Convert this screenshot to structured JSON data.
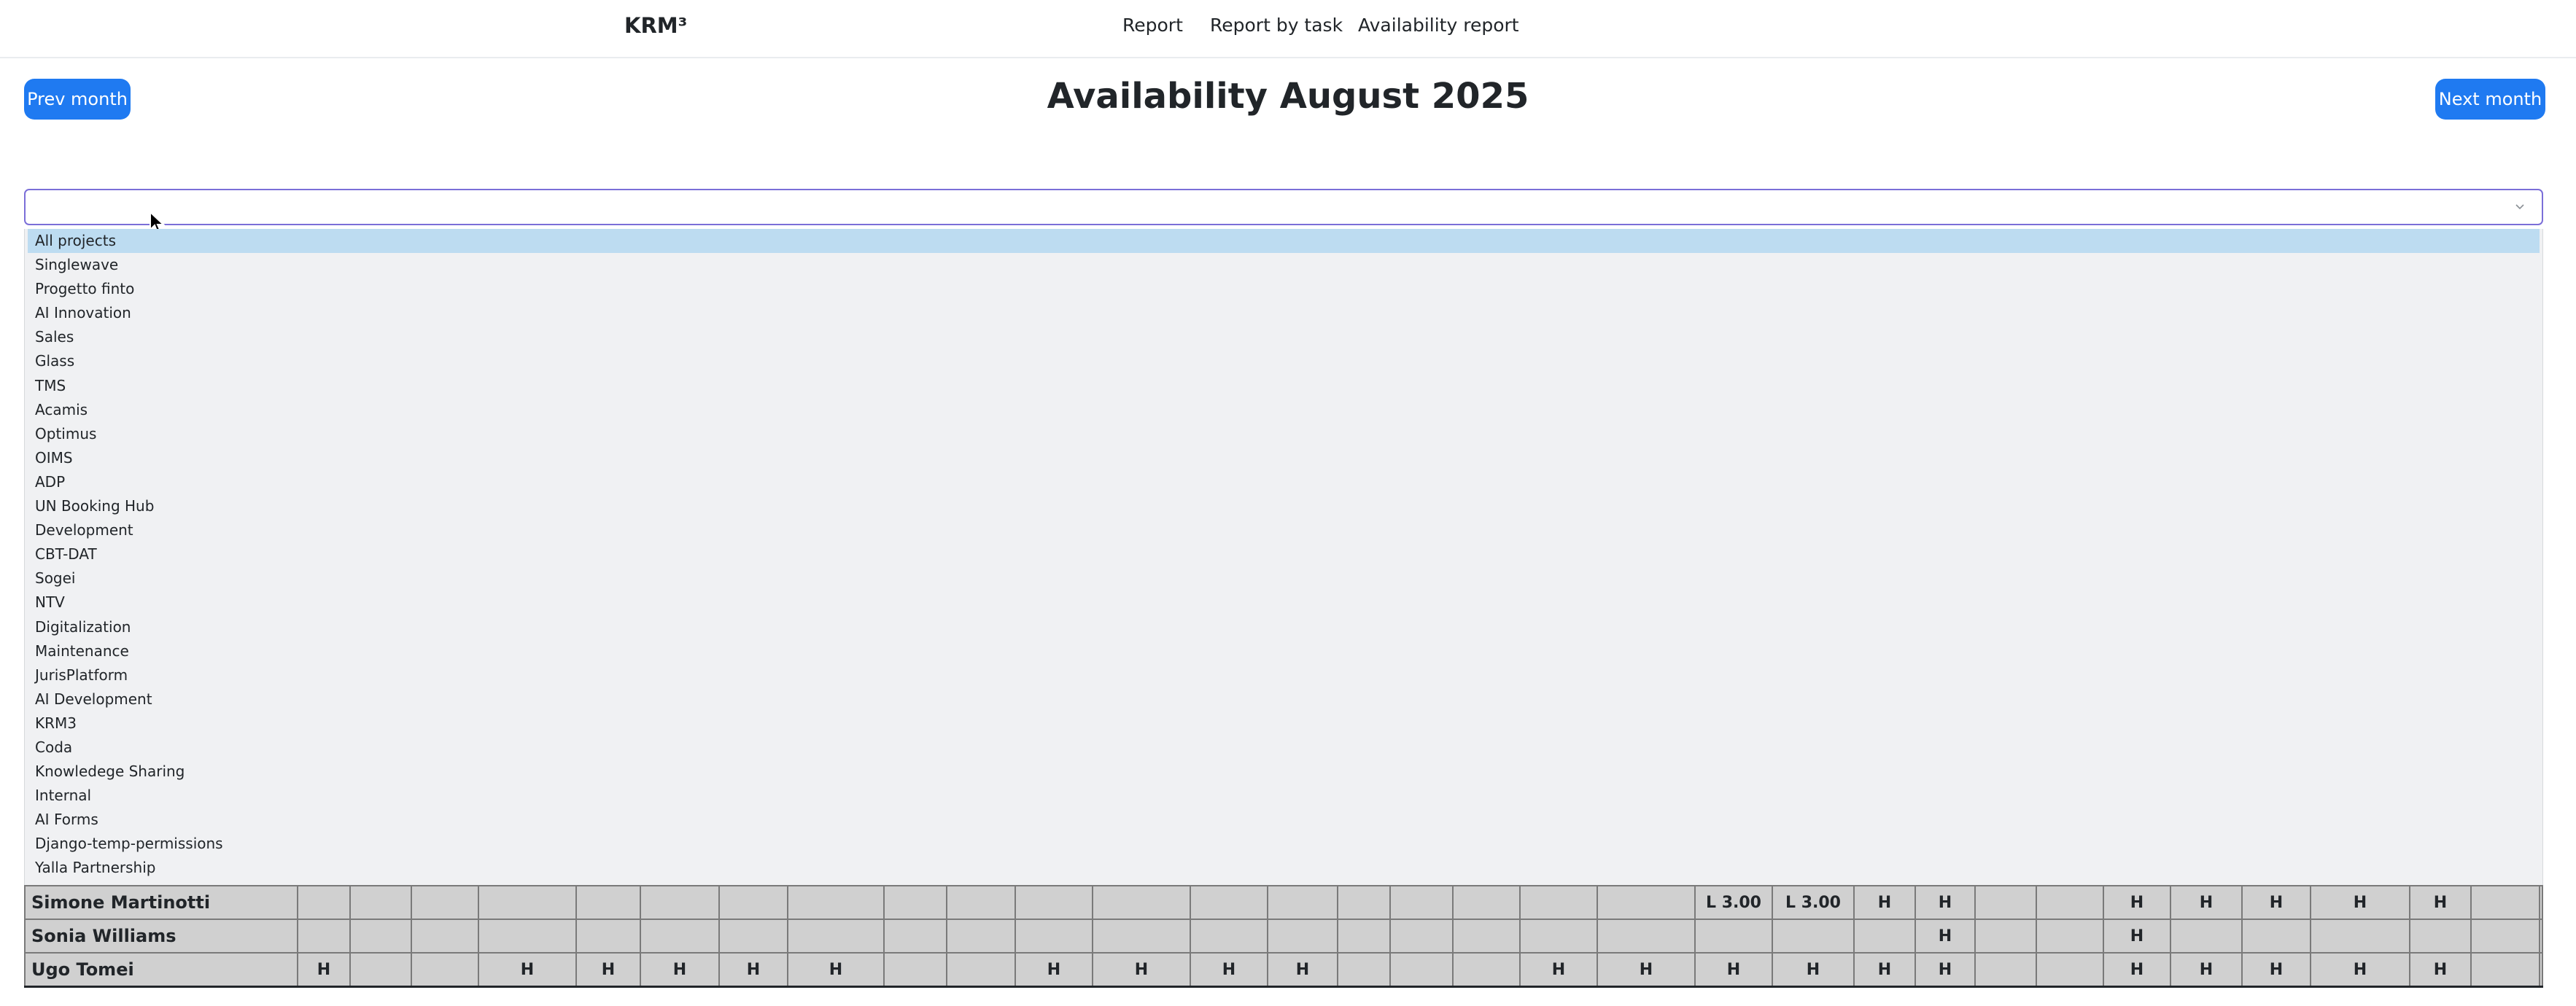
{
  "nav": {
    "brand": "KRM³",
    "links": [
      "Report",
      "Report by task",
      "Availability report"
    ]
  },
  "header": {
    "prev_label": "Prev month",
    "title": "Availability August 2025",
    "next_label": "Next month"
  },
  "project_select": {
    "value": "",
    "options": [
      "All projects",
      "Singlewave",
      "Progetto finto",
      "AI Innovation",
      "Sales",
      "Glass",
      "TMS",
      "Acamis",
      "Optimus",
      "OIMS",
      "ADP",
      "UN Booking Hub",
      "Development",
      "CBT-DAT",
      "Sogei",
      "NTV",
      "Digitalization",
      "Maintenance",
      "JurisPlatform",
      "AI Development",
      "KRM3",
      "Coda",
      "Knowledege Sharing",
      "Internal",
      "AI Forms",
      "Django-temp-permissions",
      "Yalla Partnership"
    ],
    "highlighted": "All projects"
  },
  "availability": {
    "rows": [
      {
        "name": "Simone Martinotti",
        "cells": [
          "",
          "",
          "",
          "",
          "",
          "",
          "",
          "",
          "",
          "",
          "",
          "",
          "",
          "",
          "",
          "",
          "",
          "",
          "",
          "L 3.00",
          "L 3.00",
          "H",
          "H",
          "",
          "",
          "H",
          "H",
          "H",
          "H",
          "H",
          "",
          ""
        ]
      },
      {
        "name": "Sonia Williams",
        "cells": [
          "",
          "",
          "",
          "",
          "",
          "",
          "",
          "",
          "",
          "",
          "",
          "",
          "",
          "",
          "",
          "",
          "",
          "",
          "",
          "",
          "",
          "",
          "H",
          "",
          "",
          "H",
          "",
          "",
          "",
          "",
          "",
          ""
        ]
      },
      {
        "name": "Ugo Tomei",
        "cells": [
          "H",
          "",
          "",
          "H",
          "H",
          "H",
          "H",
          "H",
          "",
          "",
          "H",
          "H",
          "H",
          "H",
          "",
          "",
          "",
          "H",
          "H",
          "H",
          "H",
          "H",
          "H",
          "",
          "",
          "H",
          "H",
          "H",
          "H",
          "H",
          "",
          ""
        ]
      }
    ]
  }
}
